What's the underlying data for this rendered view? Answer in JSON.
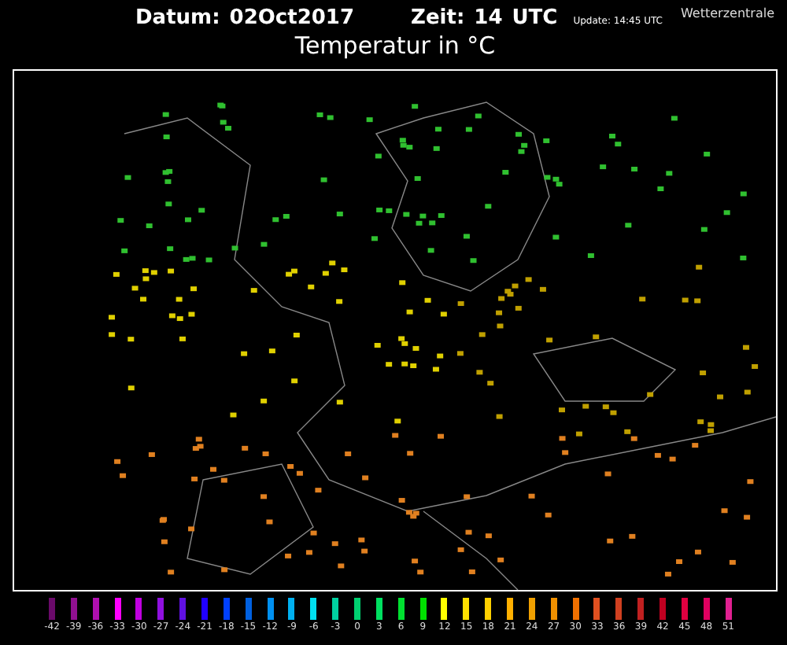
{
  "header": {
    "date_label": "Datum:",
    "date": "02Oct2017",
    "time_label": "Zeit:",
    "time": "14",
    "time_unit": "UTC",
    "update": "Update: 14:45 UTC",
    "brand": "Wetterzentrale",
    "title": "Temperatur in °C"
  },
  "legend": [
    {
      "label": "-42",
      "color": "#6a0a6a"
    },
    {
      "label": "-39",
      "color": "#901090"
    },
    {
      "label": "-36",
      "color": "#b010b0"
    },
    {
      "label": "-33",
      "color": "#ff00ff"
    },
    {
      "label": "-30",
      "color": "#c000e0"
    },
    {
      "label": "-27",
      "color": "#9010e0"
    },
    {
      "label": "-24",
      "color": "#6010e0"
    },
    {
      "label": "-21",
      "color": "#2000ff"
    },
    {
      "label": "-18",
      "color": "#0040ff"
    },
    {
      "label": "-15",
      "color": "#0060e0"
    },
    {
      "label": "-12",
      "color": "#0090f0"
    },
    {
      "label": "-9",
      "color": "#00b0f0"
    },
    {
      "label": "-6",
      "color": "#00e0f0"
    },
    {
      "label": "-3",
      "color": "#00d0a0"
    },
    {
      "label": "0",
      "color": "#00d070"
    },
    {
      "label": "3",
      "color": "#00e060"
    },
    {
      "label": "6",
      "color": "#00e030"
    },
    {
      "label": "9",
      "color": "#00e000"
    },
    {
      "label": "12",
      "color": "#ffff00"
    },
    {
      "label": "15",
      "color": "#ffe000"
    },
    {
      "label": "18",
      "color": "#ffd000"
    },
    {
      "label": "21",
      "color": "#ffb000"
    },
    {
      "label": "24",
      "color": "#f0a000"
    },
    {
      "label": "27",
      "color": "#f09000"
    },
    {
      "label": "30",
      "color": "#f07000"
    },
    {
      "label": "33",
      "color": "#e05020"
    },
    {
      "label": "36",
      "color": "#d04020"
    },
    {
      "label": "39",
      "color": "#c02020"
    },
    {
      "label": "42",
      "color": "#c00020"
    },
    {
      "label": "45",
      "color": "#e00040"
    },
    {
      "label": "48",
      "color": "#e00060"
    },
    {
      "label": "51",
      "color": "#e02090"
    }
  ]
}
